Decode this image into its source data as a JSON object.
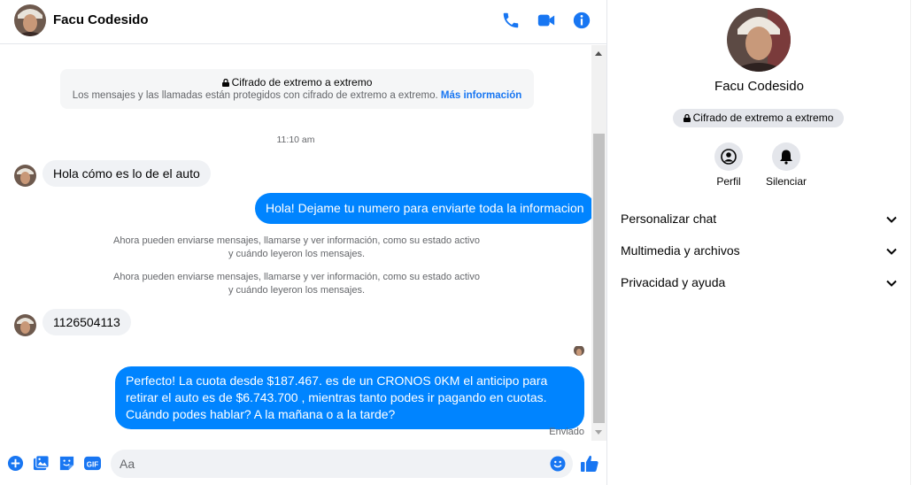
{
  "header": {
    "contact_name": "Facu Codesido"
  },
  "encryption_notice": {
    "title": "Cifrado de extremo a extremo",
    "description": "Los mensajes y las llamadas están protegidos con cifrado de extremo a extremo.",
    "link": "Más información"
  },
  "timestamp": "11:10 am",
  "messages": [
    {
      "direction": "in",
      "text": "Hola cómo es lo de el auto"
    },
    {
      "direction": "out",
      "text": "Hola! Dejame tu numero  para enviarte toda la informacion"
    },
    {
      "direction": "system",
      "line1": "Ahora pueden enviarse mensajes, llamarse y ver información, como su estado activo",
      "line2": "y cuándo leyeron los mensajes."
    },
    {
      "direction": "system",
      "line1": "Ahora pueden enviarse mensajes, llamarse y ver información, como su estado activo",
      "line2": "y cuándo leyeron los mensajes."
    },
    {
      "direction": "in",
      "text": "1126504113"
    },
    {
      "direction": "out",
      "text": "Perfecto! La cuota desde $187.467. es de un CRONOS 0KM el anticipo para retirar el auto es de $6.743.700 , mientras tanto podes ir pagando en cuotas. Cuándo podes hablar? A la mañana o a la tarde?"
    }
  ],
  "delivery_status": "Enviado",
  "composer": {
    "placeholder": "Aa"
  },
  "panel": {
    "name": "Facu Codesido",
    "badge": "Cifrado de extremo a extremo",
    "actions": [
      {
        "label": "Perfil",
        "icon": "profile-icon"
      },
      {
        "label": "Silenciar",
        "icon": "bell-icon"
      }
    ],
    "sections": [
      {
        "label": "Personalizar chat"
      },
      {
        "label": "Multimedia y archivos"
      },
      {
        "label": "Privacidad y ayuda"
      }
    ]
  },
  "colors": {
    "accent": "#0084ff",
    "icon_blue": "#1876f2",
    "incoming_bubble": "#f0f2f5",
    "secondary_text": "#65676b"
  }
}
